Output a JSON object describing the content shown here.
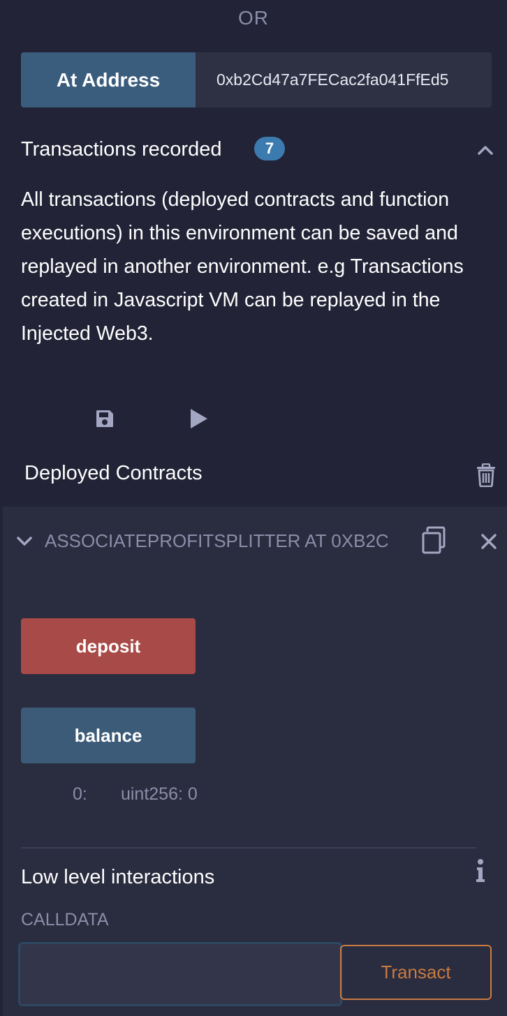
{
  "or_label": "OR",
  "at_address": {
    "button_label": "At Address",
    "input_value": "0xb2Cd47a7FECac2fa041FfEd5"
  },
  "transactions": {
    "title": "Transactions recorded",
    "count": "7",
    "description": "All transactions (deployed contracts and function executions) in this environment can be saved and replayed in another environment. e.g Transactions created in Javascript VM can be replayed in the Injected Web3."
  },
  "deployed": {
    "title": "Deployed Contracts",
    "contract": {
      "name": "ASSOCIATEPROFITSPLITTER AT 0XB2C",
      "functions": {
        "deposit_label": "deposit",
        "balance_label": "balance"
      },
      "result": {
        "index": "0:",
        "value": "uint256: 0"
      },
      "low_level": {
        "title": "Low level interactions",
        "calldata_label": "CALLDATA",
        "calldata_value": "",
        "transact_label": "Transact"
      }
    }
  },
  "icons": {
    "collapse": "chevron-up-icon",
    "save": "save-icon",
    "play": "play-icon",
    "trash": "trash-icon",
    "expand": "chevron-down-icon",
    "copy": "copy-icon",
    "close": "close-icon",
    "info": "info-icon"
  },
  "colors": {
    "background": "#222336",
    "panel": "#2a2c3f",
    "primary_button": "#3b5d7d",
    "danger_button": "#a84a47",
    "badge": "#3c7bb0",
    "transact_accent": "#c97b42",
    "muted_text": "#8a8ea8"
  }
}
